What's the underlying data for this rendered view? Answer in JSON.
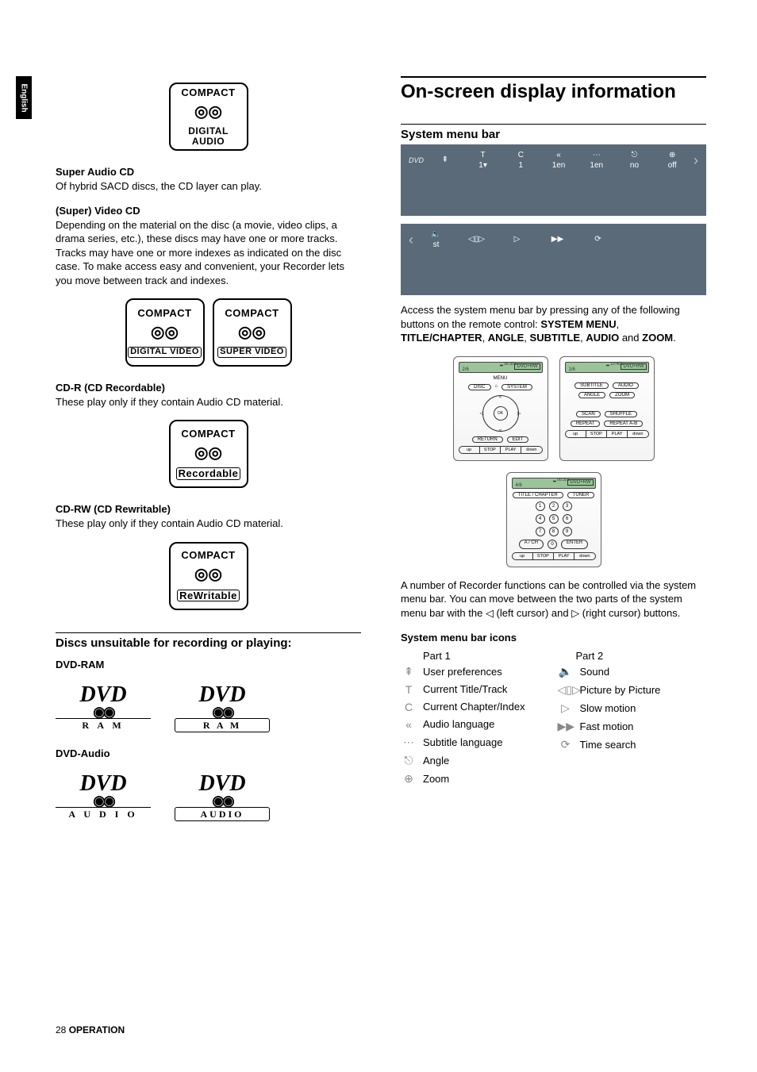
{
  "sideTab": "English",
  "left": {
    "sacd": {
      "h": "Super Audio CD",
      "p": "Of hybrid SACD discs, the CD layer can play."
    },
    "svcd": {
      "h": "(Super) Video CD",
      "p": "Depending on the material on the disc (a movie, video clips, a drama series, etc.), these discs may have one or more tracks. Tracks may have one or more indexes as indicated on the disc case. To make access easy and convenient, your Recorder lets you move between track and indexes."
    },
    "cdr": {
      "h": "CD-R (CD Recordable)",
      "p": "These play only if they contain Audio CD material."
    },
    "cdrw": {
      "h": "CD-RW (CD Rewritable)",
      "p": "These play only if they contain Audio CD material."
    },
    "unsuitable": {
      "h": "Discs unsuitable for recording or playing:",
      "ram": "DVD-RAM",
      "audio": "DVD-Audio"
    },
    "logos": {
      "compact": "COMPACT",
      "digitalAudio": "DIGITAL AUDIO",
      "digitalVideo": "DIGITAL VIDEO",
      "superVideo": "SUPER VIDEO",
      "recordable": "Recordable",
      "rewritable": "ReWritable",
      "dvd": "DVD",
      "ram": "R A M",
      "audio": "A U D I O",
      "audio2": "AUDIO"
    }
  },
  "right": {
    "h2": "On-screen display information",
    "h3": "System menu bar",
    "osd1": {
      "dvd": "DVD",
      "cells": [
        {
          "icon": "prefs",
          "val": ""
        },
        {
          "icon": "title",
          "val": "1▾"
        },
        {
          "icon": "chapter",
          "val": "1"
        },
        {
          "icon": "audio",
          "val": "1en"
        },
        {
          "icon": "subtitle",
          "val": "1en"
        },
        {
          "icon": "angle",
          "val": "no"
        },
        {
          "icon": "zoom",
          "val": "off"
        }
      ]
    },
    "osd2": {
      "cells": [
        {
          "icon": "sound",
          "val": "st"
        },
        {
          "icon": "pbp",
          "val": ""
        },
        {
          "icon": "slow",
          "val": ""
        },
        {
          "icon": "fast",
          "val": ""
        },
        {
          "icon": "time",
          "val": ""
        }
      ]
    },
    "p1a": "Access the system menu bar by pressing any of the following buttons on the remote control: ",
    "p1b": "SYSTEM MENU",
    "p1c": "TITLE/CHAPTER",
    "p1d": "ANGLE",
    "p1e": "SUBTITLE",
    "p1f": "AUDIO",
    "p1g": "ZOOM",
    "p1and": " and ",
    "p2a": "A number of Recorder functions can be controlled via the system menu bar. You can move between the two parts of the system menu bar with the ◁ (left cursor) and ▷ (right cursor) buttons.",
    "iconsHeader": "System menu bar icons",
    "part1": "Part 1",
    "part2": "Part 2",
    "icons1": [
      {
        "g": "⇞",
        "t": "User preferences"
      },
      {
        "g": "T",
        "t": "Current Title/Track"
      },
      {
        "g": "C",
        "t": "Current Chapter/Index"
      },
      {
        "g": "«",
        "t": "Audio language"
      },
      {
        "g": "⋯",
        "t": "Subtitle language"
      },
      {
        "g": "⎋",
        "t": "Angle"
      },
      {
        "g": "⊕",
        "t": "Zoom"
      }
    ],
    "icons2": [
      {
        "g": "🔈",
        "t": "Sound"
      },
      {
        "g": "◁▯▷",
        "t": "Picture by Picture"
      },
      {
        "g": "▷",
        "t": "Slow motion"
      },
      {
        "g": "▶▶",
        "t": "Fast motion"
      },
      {
        "g": "⟳",
        "t": "Time search"
      }
    ],
    "remote": {
      "rw": "DVD+RW",
      "n1": "2/6",
      "n2": "1/6",
      "n3": "4/6",
      "menu": "MENU",
      "disc": "DISC",
      "system": "SYSTEM",
      "ok": "OK",
      "return": "RETURN",
      "edit": "EDIT",
      "subtitle": "SUBTITLE",
      "audio": "AUDIO",
      "angle": "ANGLE",
      "zoom": "ZOOM",
      "scan": "SCAN",
      "shuffle": "SHUFFLE",
      "repeat": "REPEAT",
      "repeatab": "REPEAT A-B",
      "titlechapter": "TITLE / CHAPTER",
      "tuner": "TUNER",
      "ach": "A / CH",
      "enter": "ENTER",
      "up": "up",
      "stop": "STOP",
      "play": "PLAY",
      "down": "down",
      "t1": "06:30 E",
      "t2": "10:45 E"
    }
  },
  "footer": {
    "num": "28",
    "txt": "OPERATION"
  }
}
